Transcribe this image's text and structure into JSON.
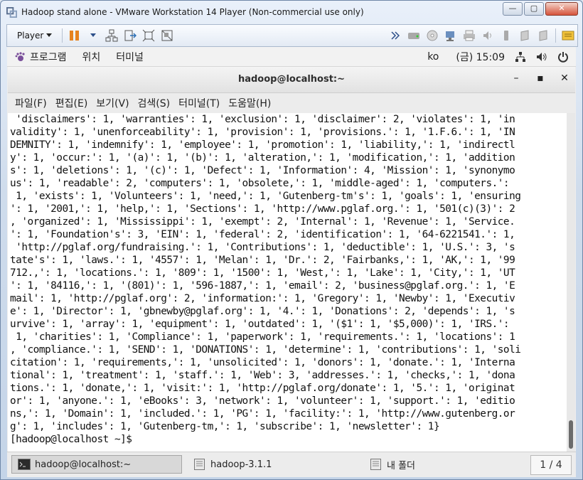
{
  "vmware": {
    "title": "Hadoop stand alone - VMware Workstation 14 Player (Non-commercial use only)",
    "controls": {
      "minimize": "—",
      "maximize": "▢",
      "close": "✕"
    },
    "toolbar": {
      "player_label": "Player"
    }
  },
  "gnome": {
    "menus": [
      "프로그램",
      "위치",
      "터미널"
    ],
    "input_method": "ko",
    "clock": "(금) 15:09"
  },
  "terminal": {
    "title": "hadoop@localhost:~",
    "controls": {
      "minimize": "–",
      "maximize": "▪",
      "close": "✕"
    },
    "menu": [
      "파일(F)",
      "편집(E)",
      "보기(V)",
      "검색(S)",
      "터미널(T)",
      "도움말(H)"
    ],
    "lines": [
      " 'disclaimers': 1, 'warranties': 1, 'exclusion': 1, 'disclaimer': 2, 'violates': 1, 'in",
      "validity': 1, 'unenforceability': 1, 'provision': 1, 'provisions.': 1, '1.F.6.': 1, 'IN",
      "DEMNITY': 1, 'indemnify': 1, 'employee': 1, 'promotion': 1, 'liability,': 1, 'indirectl",
      "y': 1, 'occur:': 1, '(a)': 1, '(b)': 1, 'alteration,': 1, 'modification,': 1, 'addition",
      "s': 1, 'deletions': 1, '(c)': 1, 'Defect': 1, 'Information': 4, 'Mission': 1, 'synonymo",
      "us': 1, 'readable': 2, 'computers': 1, 'obsolete,': 1, 'middle-aged': 1, 'computers.':",
      " 1, 'exists': 1, 'Volunteers': 1, 'need,': 1, 'Gutenberg-tm's': 1, 'goals': 1, 'ensuring",
      "': 1, '2001,': 1, 'help,': 1, 'Sections': 1, 'http://www.pglaf.org.': 1, '501(c)(3)': 2",
      ", 'organized': 1, 'Mississippi': 1, 'exempt': 2, 'Internal': 1, 'Revenue': 1, 'Service.",
      "': 1, 'Foundation's': 3, 'EIN': 1, 'federal': 2, 'identification': 1, '64-6221541.': 1,",
      " 'http://pglaf.org/fundraising.': 1, 'Contributions': 1, 'deductible': 1, 'U.S.': 3, 's",
      "tate's': 1, 'laws.': 1, '4557': 1, 'Melan': 1, 'Dr.': 2, 'Fairbanks,': 1, 'AK,': 1, '99",
      "712.,': 1, 'locations.': 1, '809': 1, '1500': 1, 'West,': 1, 'Lake': 1, 'City,': 1, 'UT",
      "': 1, '84116,': 1, '(801)': 1, '596-1887,': 1, 'email': 2, 'business@pglaf.org.': 1, 'E",
      "mail': 1, 'http://pglaf.org': 2, 'information:': 1, 'Gregory': 1, 'Newby': 1, 'Executiv",
      "e': 1, 'Director': 1, 'gbnewby@pglaf.org': 1, '4.': 1, 'Donations': 2, 'depends': 1, 's",
      "urvive': 1, 'array': 1, 'equipment': 1, 'outdated': 1, '($1': 1, '$5,000)': 1, 'IRS.':",
      " 1, 'charities': 1, 'Compliance': 1, 'paperwork': 1, 'requirements.': 1, 'locations': 1",
      ", 'compliance.': 1, 'SEND': 1, 'DONATIONS': 1, 'determine': 1, 'contributions': 1, 'soli",
      "citation': 1, 'requirements,': 1, 'unsolicited': 1, 'donors': 1, 'donate.': 1, 'Interna",
      "tional': 1, 'treatment': 1, 'staff.': 1, 'Web': 3, 'addresses.': 1, 'checks,': 1, 'dona",
      "tions.': 1, 'donate,': 1, 'visit:': 1, 'http://pglaf.org/donate': 1, '5.': 1, 'originat",
      "or': 1, 'anyone.': 1, 'eBooks': 3, 'network': 1, 'volunteer': 1, 'support.': 1, 'editio",
      "ns,': 1, 'Domain': 1, 'included.': 1, 'PG': 1, 'facility:': 1, 'http://www.gutenberg.or",
      "g': 1, 'includes': 1, 'Gutenberg-tm,': 1, 'subscribe': 1, 'newsletter': 1}",
      "[hadoop@localhost ~]$ "
    ]
  },
  "taskbar": {
    "tasks": [
      "hadoop@localhost:~",
      "hadoop-3.1.1",
      "내 폴더"
    ],
    "pager": "1 / 4"
  }
}
